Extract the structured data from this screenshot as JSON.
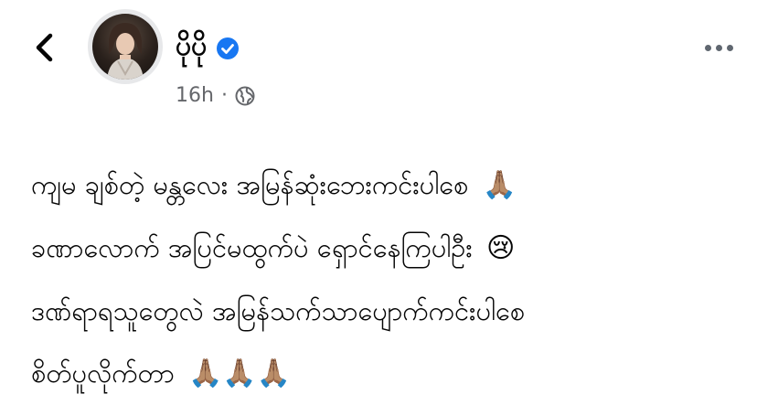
{
  "header": {
    "back_icon": "chevron-left-icon",
    "author_name": "ပိုပို",
    "verified_icon": "verified-badge-icon",
    "verified_color": "#1877f2",
    "timestamp": "16h",
    "separator": "·",
    "privacy_icon": "globe-icon",
    "more_icon": "more-horizontal-icon"
  },
  "post": {
    "lines": [
      {
        "text": "ကျမ ချစ်တဲ့ မန္တလေး အမြန်ဆုံးဘေးကင်းပါစေ",
        "emoji": "🙏🏽"
      },
      {
        "text": "ခဏာလောက် အပြင်မထွက်ပဲ ရှောင်နေကြပါဦး",
        "emoji": "😢"
      },
      {
        "text": "ဒဏ်ရာရသူတွေလဲ အမြန်သက်သာပျောက်ကင်းပါစေ",
        "emoji": ""
      },
      {
        "text": "စိတ်ပူလိုက်တာ",
        "emoji": "🙏🏽🙏🏽🙏🏽"
      }
    ]
  }
}
